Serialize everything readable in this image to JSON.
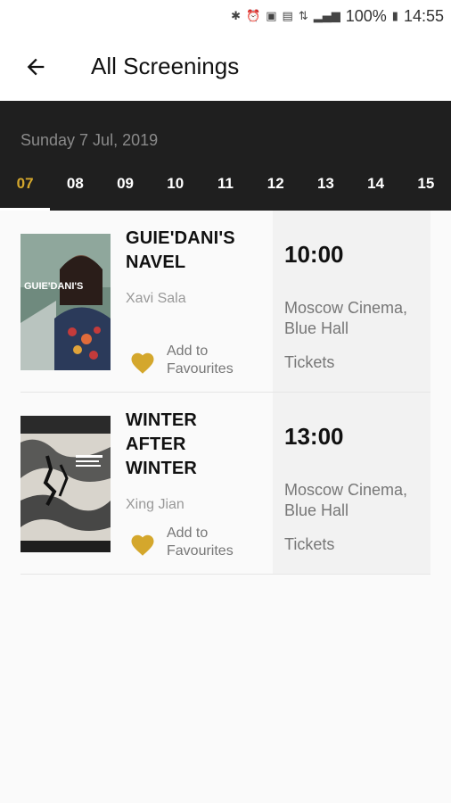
{
  "status_bar": {
    "battery": "100%",
    "time": "14:55",
    "icons": [
      "bluetooth-icon",
      "alarm-icon",
      "notification-icon",
      "sim-icon",
      "data-icon",
      "signal-icon",
      "battery-icon"
    ]
  },
  "header": {
    "title": "All Screenings",
    "back_icon": "arrow-left-icon"
  },
  "date_strip": {
    "date_label": "Sunday 7 Jul, 2019",
    "days": [
      "07",
      "08",
      "09",
      "10",
      "11",
      "12",
      "13",
      "14",
      "15"
    ],
    "active_index": 0,
    "active_color": "#d4a72c"
  },
  "screenings": [
    {
      "title_lines": [
        "GUIE'DANI'S",
        "NAVEL"
      ],
      "director": "Xavi Sala",
      "fav_line1": "Add to",
      "fav_line2": "Favourites",
      "time": "10:00",
      "venue_line1": "Moscow Cinema,",
      "venue_line2": "Blue Hall",
      "tickets": "Tickets",
      "poster_text": "GUIE'DANI'S"
    },
    {
      "title_lines": [
        "WINTER",
        "AFTER",
        "WINTER"
      ],
      "director": "Xing Jian",
      "fav_line1": "Add to",
      "fav_line2": "Favourites",
      "time": "13:00",
      "venue_line1": "Moscow Cinema,",
      "venue_line2": "Blue Hall",
      "tickets": "Tickets"
    }
  ],
  "colors": {
    "accent": "#d4a72c",
    "strip_bg": "#1f1f1f"
  }
}
